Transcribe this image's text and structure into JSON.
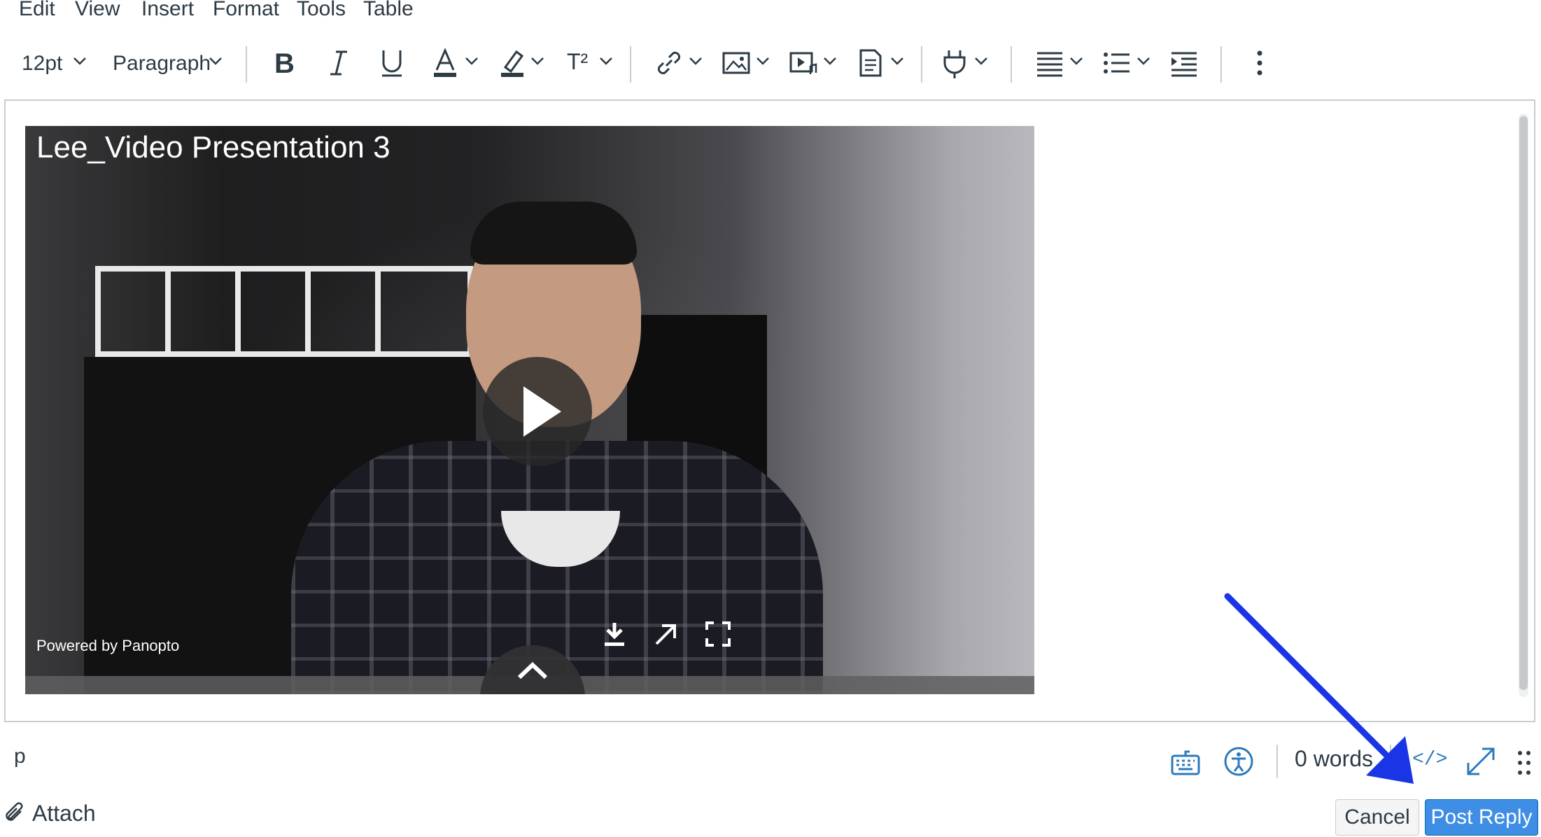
{
  "menubar": {
    "items": [
      "Edit",
      "View",
      "Insert",
      "Format",
      "Tools",
      "Table"
    ]
  },
  "toolbar": {
    "font_size": "12pt",
    "block_format": "Paragraph",
    "superscript_label": "T²",
    "icons": [
      "bold-icon",
      "italic-icon",
      "underline-icon",
      "text-color-icon",
      "highlight-icon",
      "superscript-icon",
      "link-icon",
      "image-icon",
      "media-icon",
      "document-icon",
      "apps-plug-icon",
      "align-icon",
      "list-icon",
      "indent-icon",
      "more-vertical-icon"
    ]
  },
  "video": {
    "title": "Lee_Video Presentation 3",
    "powered_by": "Powered by Panopto"
  },
  "status": {
    "element_path": "p",
    "word_count": "0 words",
    "html_editor_label": "</>"
  },
  "actions": {
    "attach_label": "Attach",
    "cancel_label": "Cancel",
    "post_reply_label": "Post Reply"
  },
  "colors": {
    "primary_button": "#3f8ee6",
    "annotation_arrow": "#1a35e6",
    "icon_blue": "#2b7abc",
    "text": "#2d3b45"
  }
}
